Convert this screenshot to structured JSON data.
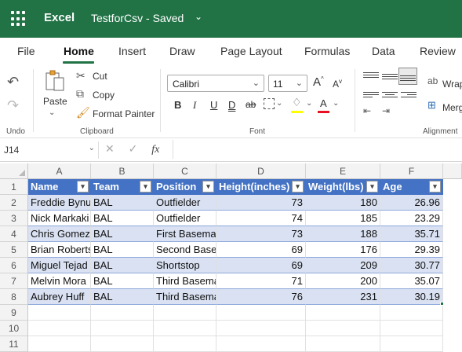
{
  "app": {
    "name": "Excel",
    "doc_title": "TestforCsv - Saved"
  },
  "menu": [
    "File",
    "Home",
    "Insert",
    "Draw",
    "Page Layout",
    "Formulas",
    "Data",
    "Review"
  ],
  "ribbon": {
    "paste": "Paste",
    "cut": "Cut",
    "copy": "Copy",
    "format_painter": "Format Painter",
    "font_name": "Calibri",
    "font_size": "11",
    "wrap": "Wrap",
    "merge": "Merg",
    "groups": {
      "undo": "Undo",
      "clipboard": "Clipboard",
      "font": "Font",
      "alignment": "Alignment"
    }
  },
  "formula_bar": {
    "name_box": "J14",
    "fx": "fx"
  },
  "columns": [
    "A",
    "B",
    "C",
    "D",
    "E",
    "F"
  ],
  "rows": [
    "1",
    "2",
    "3",
    "4",
    "5",
    "6",
    "7",
    "8",
    "9",
    "10",
    "11"
  ],
  "table": {
    "headers": [
      "Name",
      "Team",
      "Position",
      "Height(inches)",
      "Weight(lbs)",
      "Age"
    ],
    "data": [
      [
        "Freddie Bynu",
        "BAL",
        " Outfielder",
        "73",
        "180",
        "26.96"
      ],
      [
        "Nick Markaki",
        "BAL",
        " Outfielder",
        "74",
        "185",
        "23.29"
      ],
      [
        "Chris Gomez",
        "BAL",
        "First Basemai",
        "73",
        "188",
        "35.71"
      ],
      [
        "Brian Roberts",
        "BAL",
        "Second Baser",
        "69",
        "176",
        "29.39"
      ],
      [
        "Miguel Tejad",
        "BAL",
        "Shortstop",
        "69",
        "209",
        "30.77"
      ],
      [
        "Melvin Mora",
        "BAL",
        "Third Basema",
        "71",
        "200",
        "35.07"
      ],
      [
        "Aubrey Huff",
        "BAL",
        "Third Basema",
        "76",
        "231",
        "30.19"
      ]
    ]
  },
  "colors": {
    "brand": "#217346",
    "table_header": "#4472c4",
    "band": "#d9e1f2"
  }
}
